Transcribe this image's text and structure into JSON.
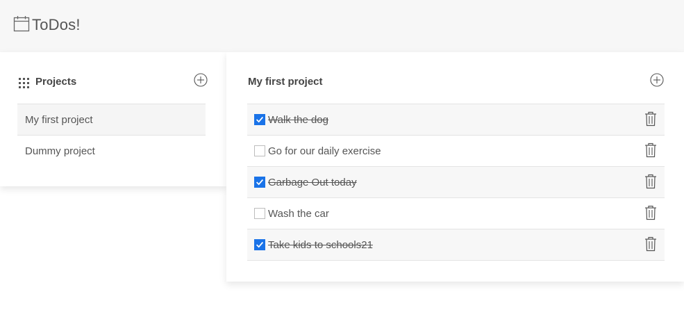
{
  "app": {
    "title": "ToDos!",
    "icon": "calendar-icon"
  },
  "colors": {
    "accent": "#1a73e8",
    "topbar_bg": "#f7f7f7",
    "row_shade": "#f7f7f7"
  },
  "sidebar": {
    "title": "Projects",
    "title_icon": "grid-icon",
    "add_icon": "add-circle-icon",
    "projects": [
      {
        "label": "My first project",
        "active": true
      },
      {
        "label": "Dummy project",
        "active": false
      }
    ]
  },
  "main": {
    "title": "My first project",
    "add_icon": "add-circle-icon",
    "todos": [
      {
        "label": "Walk the dog",
        "done": true
      },
      {
        "label": "Go for our daily exercise",
        "done": false
      },
      {
        "label": "Garbage Out today",
        "done": true
      },
      {
        "label": "Wash the car",
        "done": false
      },
      {
        "label": "Take kids to schools21",
        "done": true
      }
    ]
  }
}
